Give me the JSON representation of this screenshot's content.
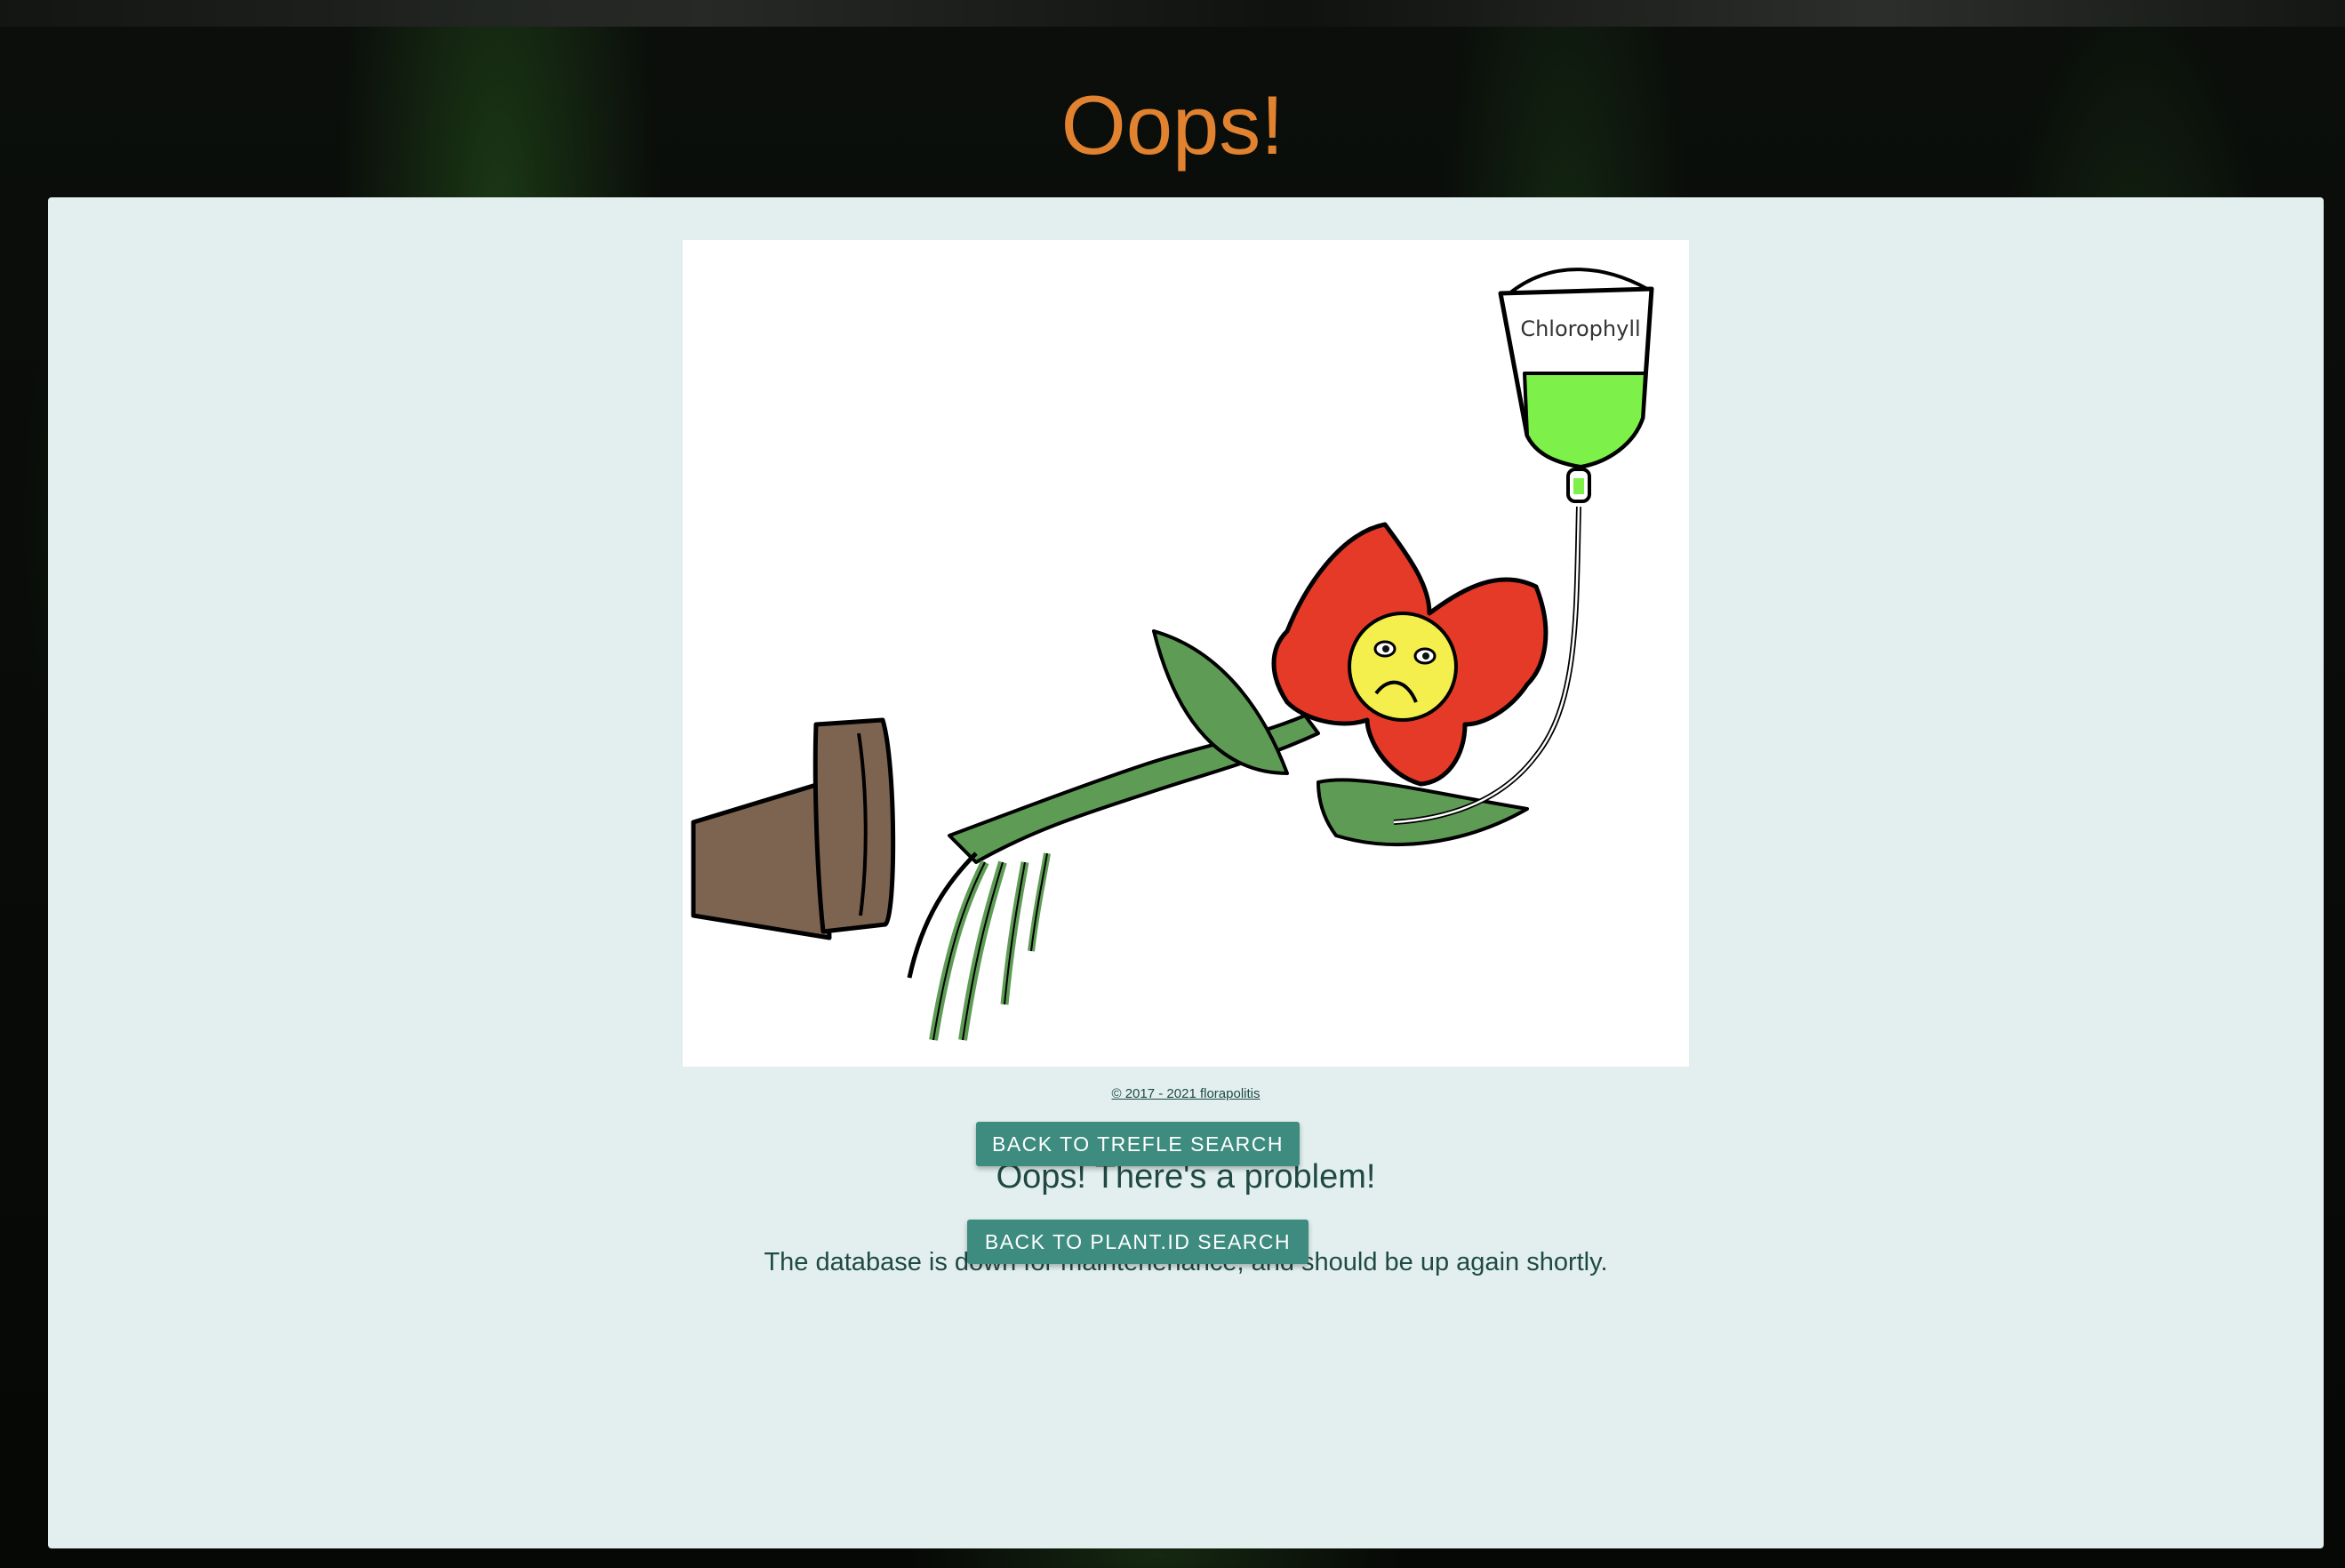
{
  "page": {
    "title": "Oops!",
    "title_color": "#e0822f",
    "card_background": "#e2efee"
  },
  "illustration": {
    "label_on_bag": "Chlorophyll",
    "description_icon": "wilting-flower-on-iv-drip-illustration"
  },
  "footer": {
    "copyright": "© 2017 - 2021 florapolitis"
  },
  "error": {
    "heading": "Oops! There's a problem!",
    "message": "The database is down for maintenenance, and should be up again shortly."
  },
  "buttons": {
    "trefle_label": "BACK TO TREFLE SEARCH",
    "plantid_label": "BACK TO PLANT.ID SEARCH",
    "color": "#3e8c80"
  }
}
